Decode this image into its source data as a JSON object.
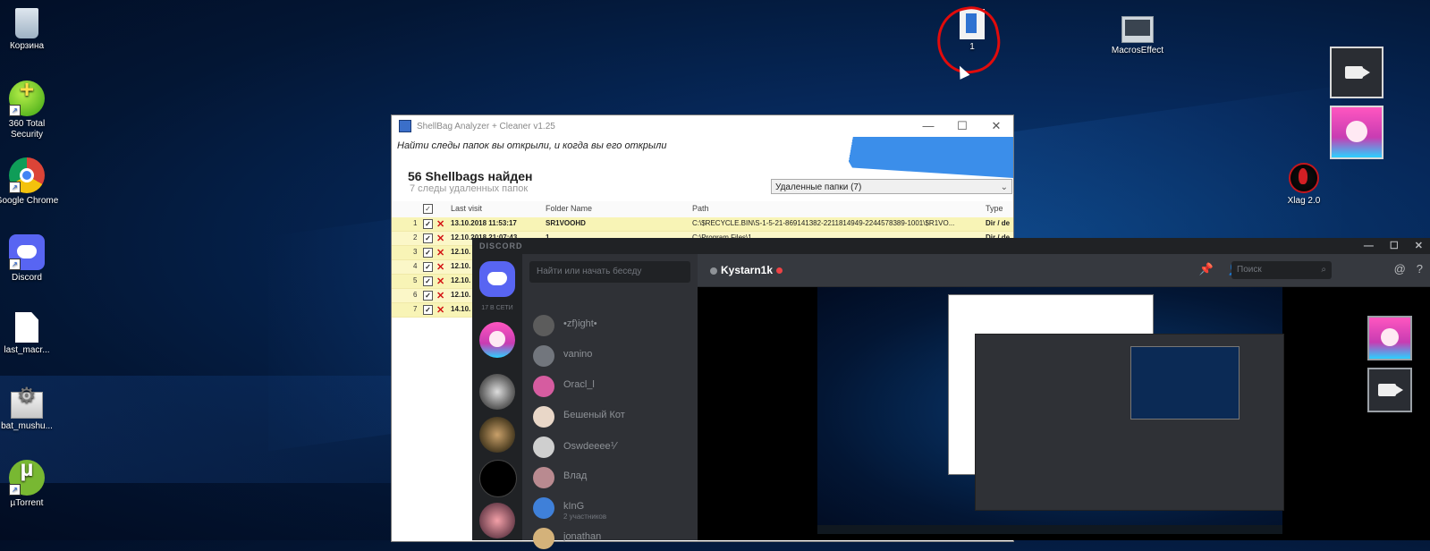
{
  "desktop": {
    "icons": [
      {
        "label": "Корзина"
      },
      {
        "label": "360 Total Security"
      },
      {
        "label": "Google Chrome"
      },
      {
        "label": "Discord"
      },
      {
        "label": "last_macr..."
      },
      {
        "label": "bat_mushu..."
      },
      {
        "label": "µTorrent"
      }
    ],
    "top_icons": [
      {
        "label": "1"
      },
      {
        "label": "MacrosEffect"
      }
    ],
    "right_icons": [
      {
        "label": "Xlag 2.0"
      }
    ]
  },
  "shellbag": {
    "title": "ShellBag Analyzer + Cleaner v1.25",
    "subtitle": "Найти следы папок вы открыли, и когда вы его открыли",
    "heading": "56 Shellbags найден",
    "count_text": "7  следы удаленных папок",
    "filter_value": "Удаленные папки  (7)",
    "columns": {
      "last_visit": "Last visit",
      "folder_name": "Folder Name",
      "path": "Path",
      "type": "Type"
    },
    "rows": [
      {
        "num": "1",
        "visit": "13.10.2018 11:53:17",
        "folder": "SR1VOOHD",
        "path": "C:\\$RECYCLE.BIN\\S-1-5-21-869141382-2211814949-2244578389-1001\\$R1VO...",
        "type": "Dir / de"
      },
      {
        "num": "2",
        "visit": "12.10.2018 21:07:43",
        "folder": "1",
        "path": "C:\\Program Files\\1",
        "type": "Dir / de"
      },
      {
        "num": "3",
        "visit": "12.10.",
        "folder": "",
        "path": "",
        "type": ""
      },
      {
        "num": "4",
        "visit": "12.10.",
        "folder": "",
        "path": "",
        "type": ""
      },
      {
        "num": "5",
        "visit": "12.10.",
        "folder": "",
        "path": "",
        "type": ""
      },
      {
        "num": "6",
        "visit": "12.10.",
        "folder": "",
        "path": "",
        "type": ""
      },
      {
        "num": "7",
        "visit": "14.10.",
        "folder": "",
        "path": "",
        "type": ""
      }
    ]
  },
  "discord": {
    "title": "DISCORD",
    "online_text": "17 В СЕТИ",
    "search_placeholder": "Найти или начать беседу",
    "channel_user": "Kystarn1k",
    "header_search": "Поиск",
    "dms": [
      {
        "name": "•zf)ight•",
        "sub": ""
      },
      {
        "name": "vanino",
        "sub": ""
      },
      {
        "name": "Oracl_l",
        "sub": ""
      },
      {
        "name": "Бешеный Кот",
        "sub": ""
      },
      {
        "name": "Oswdeeee⅟",
        "sub": ""
      },
      {
        "name": "Влад",
        "sub": ""
      },
      {
        "name": "kInG",
        "sub": "2 участников"
      },
      {
        "name": "jonathan",
        "sub": ""
      }
    ],
    "colors": {
      "bg": "#202225",
      "sidebar": "#2f3136",
      "main": "#36393f",
      "brand": "#5865f2"
    }
  }
}
